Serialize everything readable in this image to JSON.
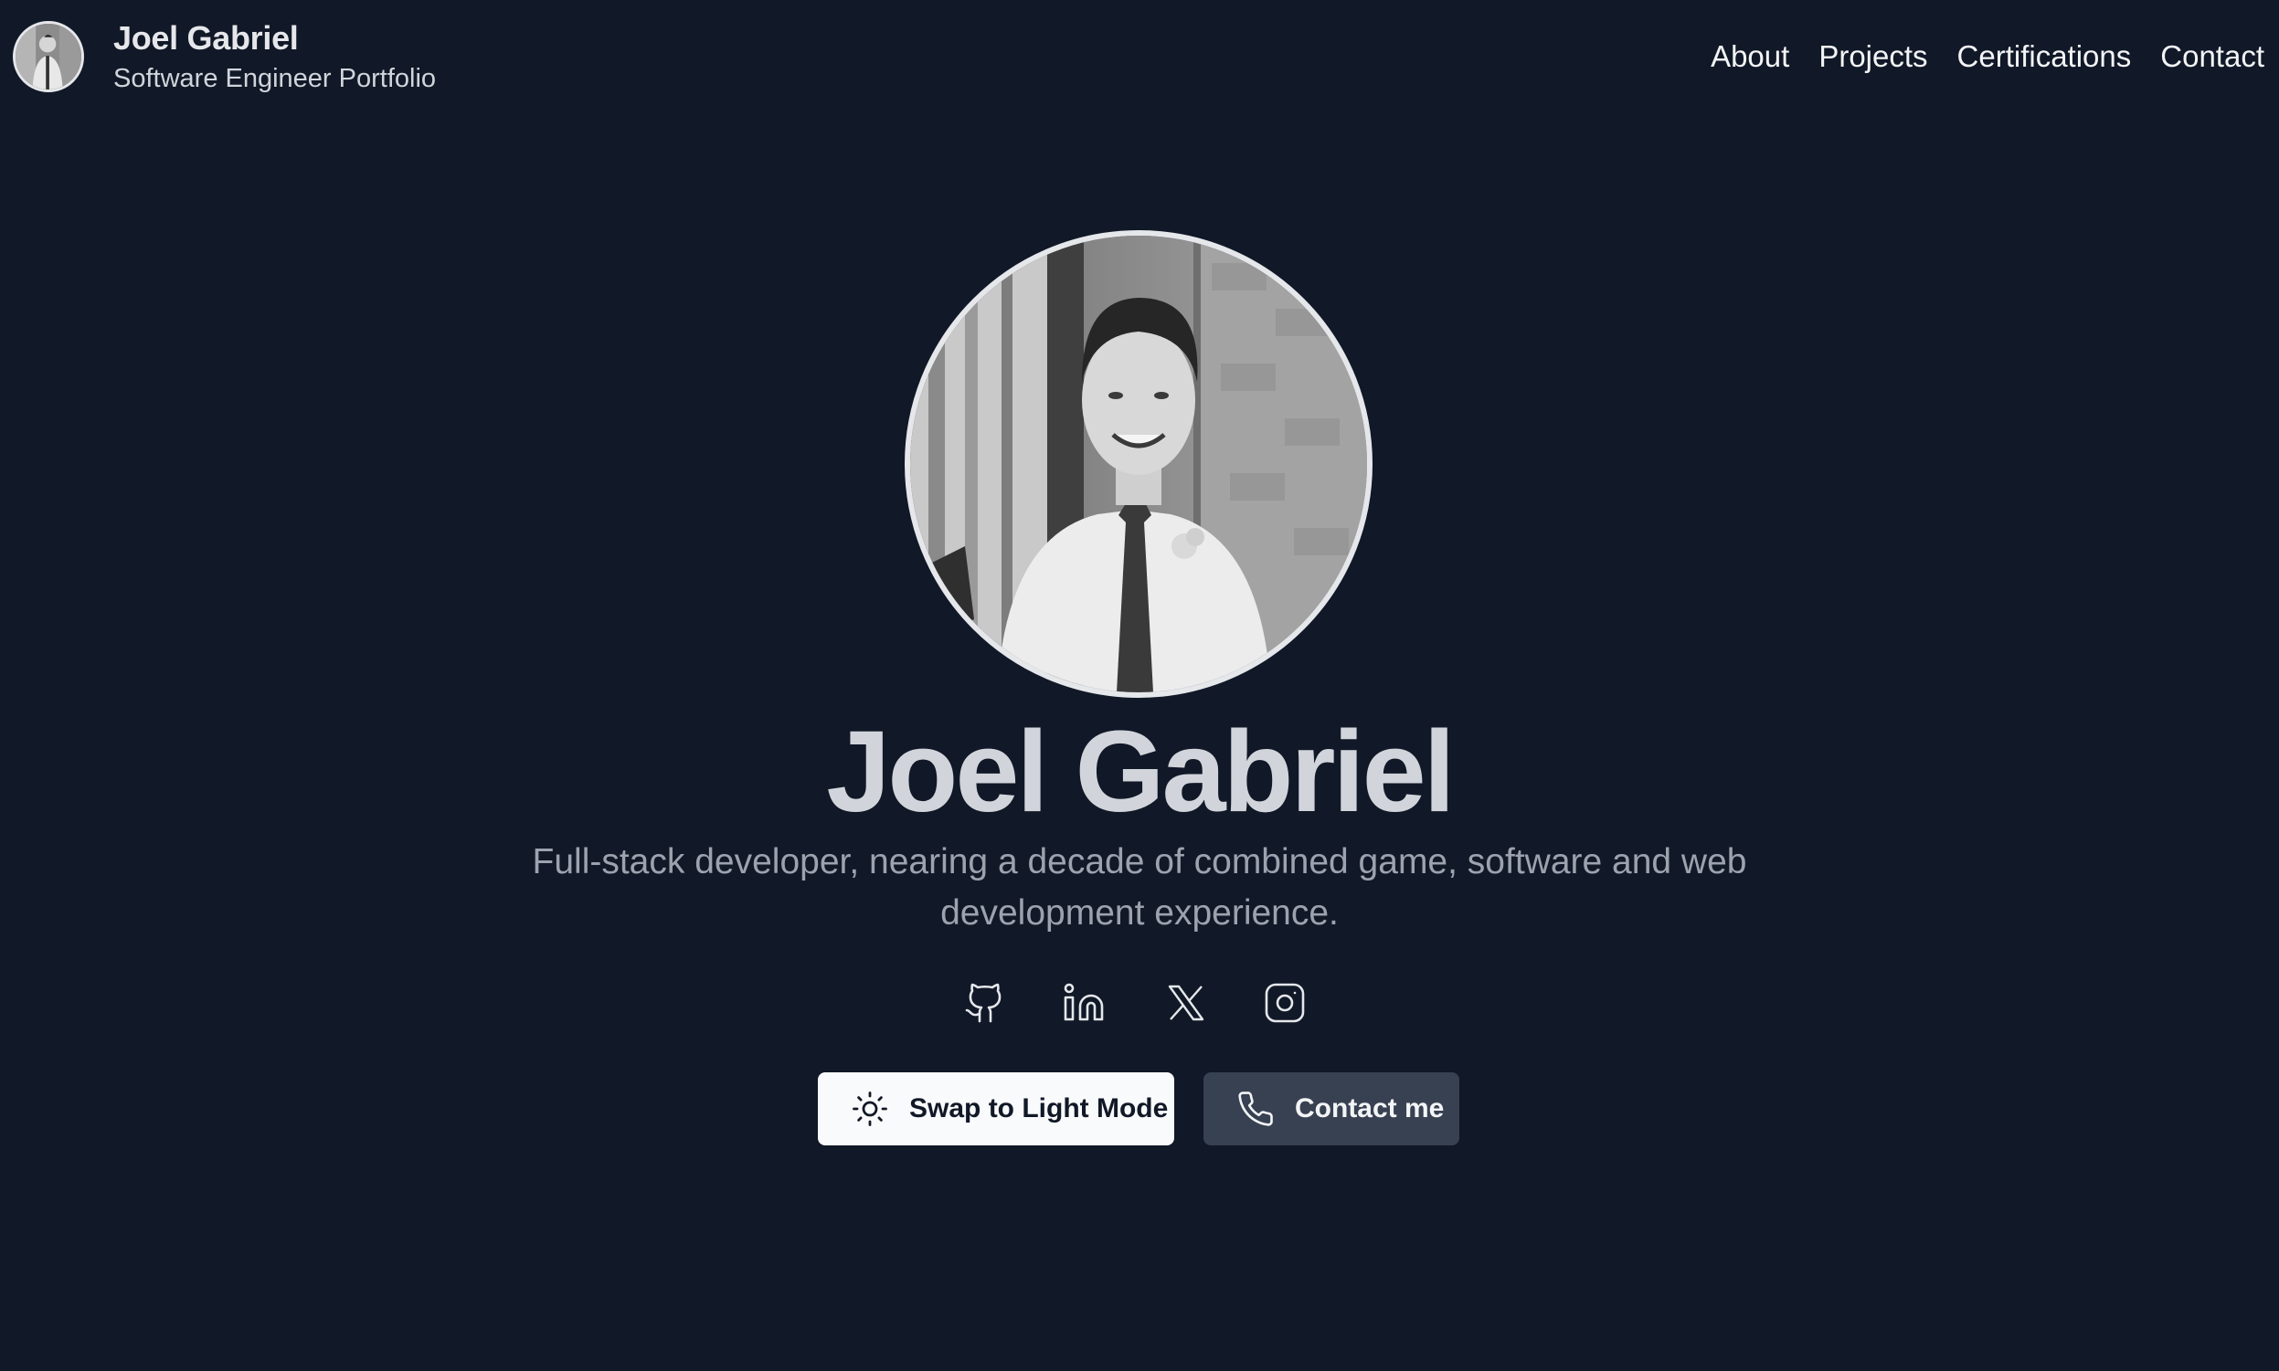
{
  "header": {
    "name": "Joel Gabriel",
    "subtitle": "Software Engineer Portfolio",
    "avatar_icon": "profile-photo",
    "nav": [
      {
        "label": "About"
      },
      {
        "label": "Projects"
      },
      {
        "label": "Certifications"
      },
      {
        "label": "Contact"
      }
    ]
  },
  "hero": {
    "photo_icon": "profile-photo",
    "title": "Joel Gabriel",
    "description": "Full-stack developer, nearing a decade of combined game, software and web development experience."
  },
  "socials": [
    {
      "icon": "github-icon"
    },
    {
      "icon": "linkedin-icon"
    },
    {
      "icon": "x-twitter-icon"
    },
    {
      "icon": "instagram-icon"
    }
  ],
  "buttons": {
    "theme_toggle": {
      "label": "Swap to Light Mode",
      "icon": "sun-icon"
    },
    "contact": {
      "label": "Contact me",
      "icon": "phone-icon"
    }
  },
  "colors": {
    "background": "#111827",
    "text_primary": "#e5e7eb",
    "text_muted": "#9ca3af",
    "button_light": "#f9fafb",
    "button_dark": "#374151"
  }
}
